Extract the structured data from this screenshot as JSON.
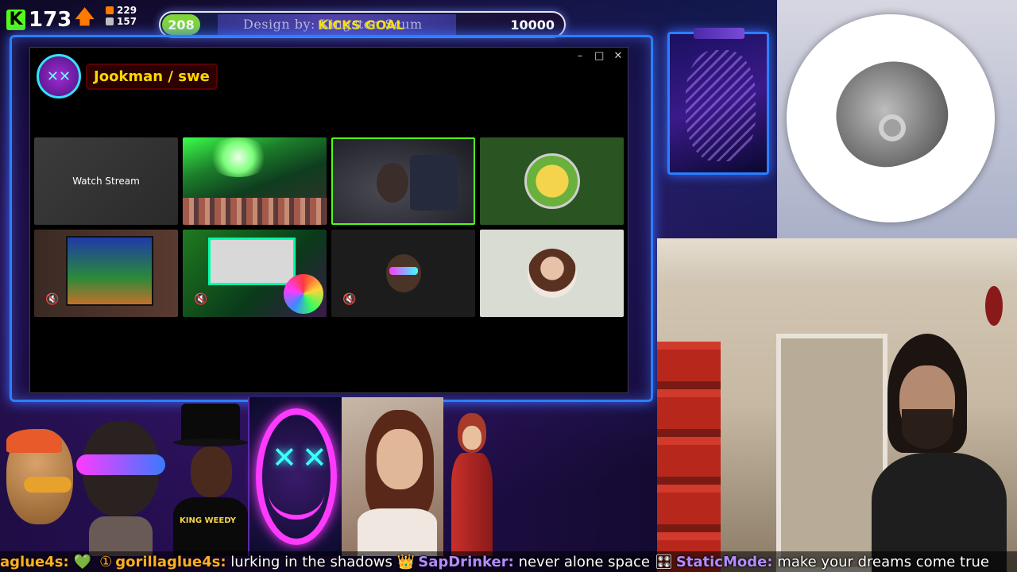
{
  "hud": {
    "kick_count": "173",
    "stat_a": "229",
    "stat_b": "157"
  },
  "goal": {
    "current": "208",
    "design_text": "Design by: Kingston Scum",
    "label": "KICKS GOAL",
    "target": "10000",
    "progress_fraction": 0.0208
  },
  "window": {
    "channel_name": "Jookman / swe",
    "controls": [
      "–",
      "□",
      "✕"
    ],
    "tile1_label": "Watch Stream"
  },
  "webcam": {},
  "shirt_text": "KING WEEDY",
  "ticker": {
    "items": [
      {
        "user": "aglue4s:",
        "icon": "💚",
        "message": ""
      },
      {
        "user": "gorillaglue4s:",
        "icon": "①",
        "message": "lurking in the shadows"
      },
      {
        "user": "SapDrinker:",
        "icon": "👑",
        "message": "never alone space"
      },
      {
        "user": "StaticMode:",
        "icon": "🎛",
        "message": "make your dreams come true"
      }
    ]
  },
  "colors": {
    "accent_green": "#53fc18",
    "frame_blue": "#2b7fff",
    "goal_yellow": "#ffe600",
    "name_gold": "#ffd700"
  }
}
